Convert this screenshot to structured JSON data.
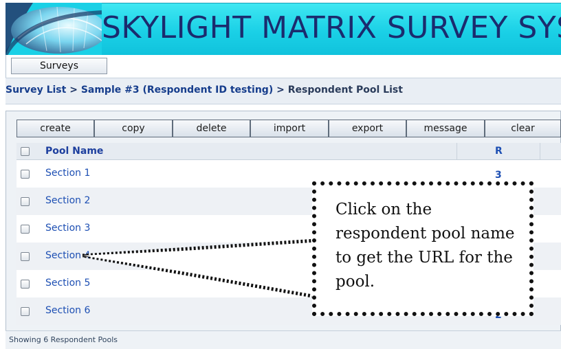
{
  "app": {
    "title": "SKYLIGHT MATRIX SURVEY SYST"
  },
  "menu": {
    "surveys_label": "Surveys"
  },
  "breadcrumb": {
    "items": [
      "Survey List",
      "Sample #3 (Respondent ID testing)",
      "Respondent Pool List"
    ],
    "separator": ">"
  },
  "toolbar": {
    "buttons": [
      "create",
      "copy",
      "delete",
      "import",
      "export",
      "message",
      "clear"
    ]
  },
  "table": {
    "columns": [
      "Pool Name",
      "R"
    ],
    "rows": [
      {
        "name": "Section 1",
        "r": "3"
      },
      {
        "name": "Section 2",
        "r": ""
      },
      {
        "name": "Section 3",
        "r": ""
      },
      {
        "name": "Section 4",
        "r": ""
      },
      {
        "name": "Section 5",
        "r": ""
      },
      {
        "name": "Section 6",
        "r": "2"
      }
    ]
  },
  "footer": {
    "status": "Showing 6 Respondent Pools"
  },
  "callout": {
    "text": "Click on the respondent pool name to get the URL for the pool."
  },
  "colors": {
    "banner": "#1ad0e6",
    "title": "#1b2b6e",
    "link": "#1d4fb3",
    "breadcrumb": "#163d8c"
  }
}
